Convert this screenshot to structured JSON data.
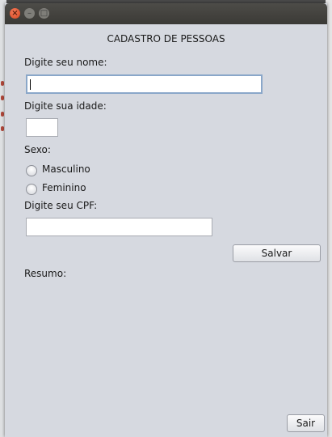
{
  "window": {
    "controls": {
      "close_glyph": "×",
      "minimize_glyph": "–",
      "maximize_glyph": "□"
    }
  },
  "form": {
    "heading": "CADASTRO DE PESSOAS",
    "name_label": "Digite seu nome:",
    "name_value": "",
    "age_label": "Digite sua idade:",
    "age_value": "",
    "sex_label": "Sexo:",
    "sex_options": [
      {
        "label": "Masculino",
        "selected": false
      },
      {
        "label": "Feminino",
        "selected": false
      }
    ],
    "cpf_label": "Digite seu CPF:",
    "cpf_value": "",
    "save_button": "Salvar",
    "summary_label": "Resumo:",
    "exit_button": "Sair"
  },
  "colors": {
    "window_background": "#d6d9e0",
    "titlebar": "#3b3a36",
    "close_button": "#e05a2f",
    "focus_border": "#8aa7c9"
  }
}
